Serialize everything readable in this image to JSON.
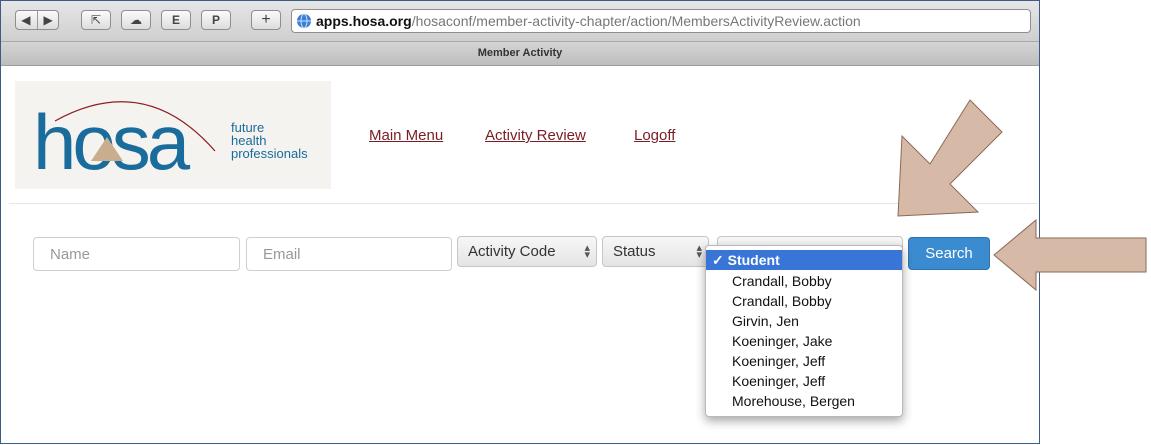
{
  "browser": {
    "url_host": "apps.hosa.org",
    "url_path": "/hosaconf/member-activity-chapter/action/MembersActivityReview.action",
    "page_title": "Member Activity"
  },
  "logo": {
    "wordmark": "hosa",
    "tagline_1": "future",
    "tagline_2": "health",
    "tagline_3": "professionals"
  },
  "nav": {
    "main_menu": "Main Menu",
    "activity_review": "Activity Review",
    "logoff": "Logoff"
  },
  "filters": {
    "name_placeholder": "Name",
    "email_placeholder": "Email",
    "activity_code": "Activity Code",
    "status": "Status",
    "search_label": "Search"
  },
  "dropdown": {
    "selected_mark": "✓",
    "items": [
      "Student",
      "Crandall, Bobby",
      "Crandall, Bobby",
      "Girvin, Jen",
      "Koeninger, Jake",
      "Koeninger, Jeff",
      "Koeninger, Jeff",
      "Morehouse, Bergen"
    ]
  },
  "colors": {
    "link": "#7a1d24",
    "button": "#3b8bd0",
    "logo_blue": "#1a6c9c",
    "annotation_arrow": "#d6b9a6"
  }
}
